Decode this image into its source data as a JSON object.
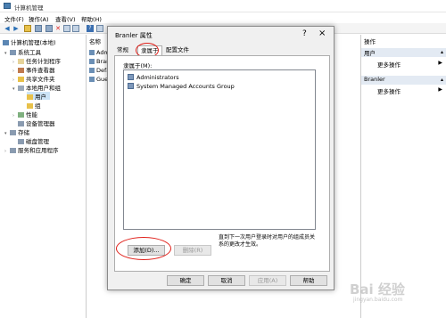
{
  "window": {
    "title": "计算机管理"
  },
  "menu": [
    "文件(F)",
    "操作(A)",
    "查看(V)",
    "帮助(H)"
  ],
  "tree": {
    "root": "计算机管理(本地)",
    "items": [
      {
        "label": "系统工具",
        "level": 1
      },
      {
        "label": "任务计划程序",
        "level": 2
      },
      {
        "label": "事件查看器",
        "level": 2
      },
      {
        "label": "共享文件夹",
        "level": 2
      },
      {
        "label": "本地用户和组",
        "level": 2
      },
      {
        "label": "用户",
        "level": 3,
        "selected": true
      },
      {
        "label": "组",
        "level": 3
      },
      {
        "label": "性能",
        "level": 2
      },
      {
        "label": "设备管理器",
        "level": 2
      },
      {
        "label": "存储",
        "level": 1
      },
      {
        "label": "磁盘管理",
        "level": 2
      },
      {
        "label": "服务和应用程序",
        "level": 1
      }
    ]
  },
  "list": {
    "header": "名称",
    "rows": [
      "Admi",
      "Branl",
      "Defa",
      "Gues"
    ]
  },
  "actions": {
    "header": "操作",
    "sections": [
      {
        "title": "用户",
        "item": "更多操作"
      },
      {
        "title": "Branler",
        "item": "更多操作"
      }
    ]
  },
  "dialog": {
    "title": "Branler 属性",
    "help": "?",
    "close": "×",
    "tabs": [
      "常规",
      "隶属于",
      "配置文件"
    ],
    "member_of_label": "隶属于(M):",
    "members": [
      "Administrators",
      "System Managed Accounts Group"
    ],
    "add_button": "添加(D)...",
    "remove_button": "删除(R)",
    "note": "直到下一次用户登录时对用户的组成员关系的更改才生效。",
    "ok": "确定",
    "cancel": "取消",
    "apply": "应用(A)",
    "help_button": "帮助"
  },
  "watermark": {
    "main": "Bai 经验",
    "sub": "jingyan.baidu.com"
  }
}
